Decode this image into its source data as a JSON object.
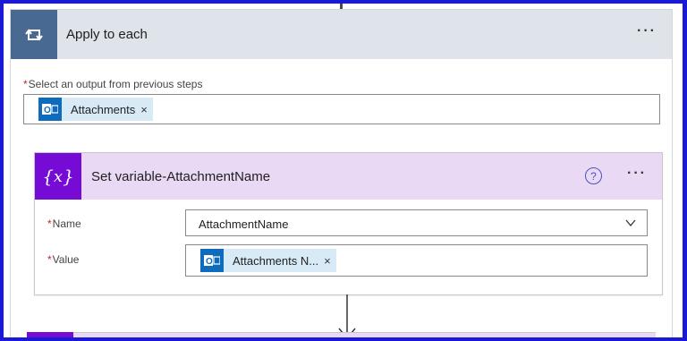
{
  "apply_to_each": {
    "title": "Apply to each",
    "more_label": "···",
    "select_output_label": "Select an output from previous steps",
    "required_marker": "*",
    "token": {
      "label": "Attachments",
      "remove": "×",
      "icon": "outlook-icon"
    }
  },
  "set_variable": {
    "title": "Set variable-AttachmentName",
    "help_label": "?",
    "more_label": "···",
    "name_label": "Name",
    "name_value": "AttachmentName",
    "value_label": "Value",
    "value_token": {
      "label": "Attachments N...",
      "remove": "×",
      "icon": "outlook-icon"
    }
  },
  "colors": {
    "apply_header_bg": "#dfe4ea",
    "apply_icon_bg": "#486991",
    "setvar_header_bg": "#ead9f5",
    "setvar_icon_bg": "#770bd6",
    "token_bg": "#d9eaf7",
    "frame_border": "#1a1ad6",
    "required": "#c4262e"
  }
}
